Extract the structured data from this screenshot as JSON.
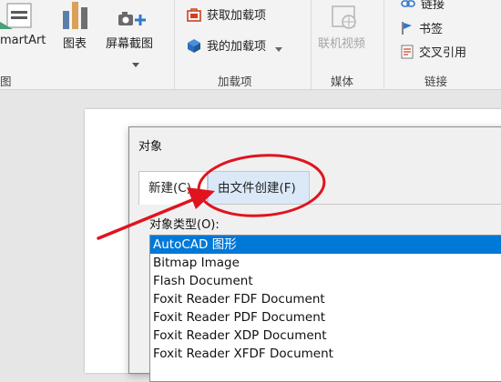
{
  "ribbon": {
    "smartart_label": "martArt",
    "chart_label": "图表",
    "screenshot_label": "屏幕截图",
    "left_group_label": "图",
    "get_addins_label": "获取加载项",
    "my_addins_label": "我的加载项",
    "addins_group_label": "加载项",
    "online_video_label": "联机视频",
    "media_group_label": "媒体",
    "link_label": "链接",
    "bookmark_label": "书签",
    "cross_ref_label": "交叉引用",
    "links_group_label": "链接"
  },
  "dialog": {
    "title": "对象",
    "tabs": [
      {
        "label": "新建(C)"
      },
      {
        "label": "由文件创建(F)"
      }
    ],
    "object_type_label": "对象类型(O):",
    "object_types": [
      {
        "label": "AutoCAD 图形",
        "selected": true
      },
      {
        "label": "Bitmap Image"
      },
      {
        "label": "Flash Document"
      },
      {
        "label": "Foxit Reader FDF Document"
      },
      {
        "label": "Foxit Reader PDF Document"
      },
      {
        "label": "Foxit Reader XDP Document"
      },
      {
        "label": "Foxit Reader XFDF Document"
      }
    ]
  },
  "colors": {
    "selection": "#0078d7",
    "annotation": "#e0141e",
    "tab_highlight": "#dbe8f8"
  }
}
